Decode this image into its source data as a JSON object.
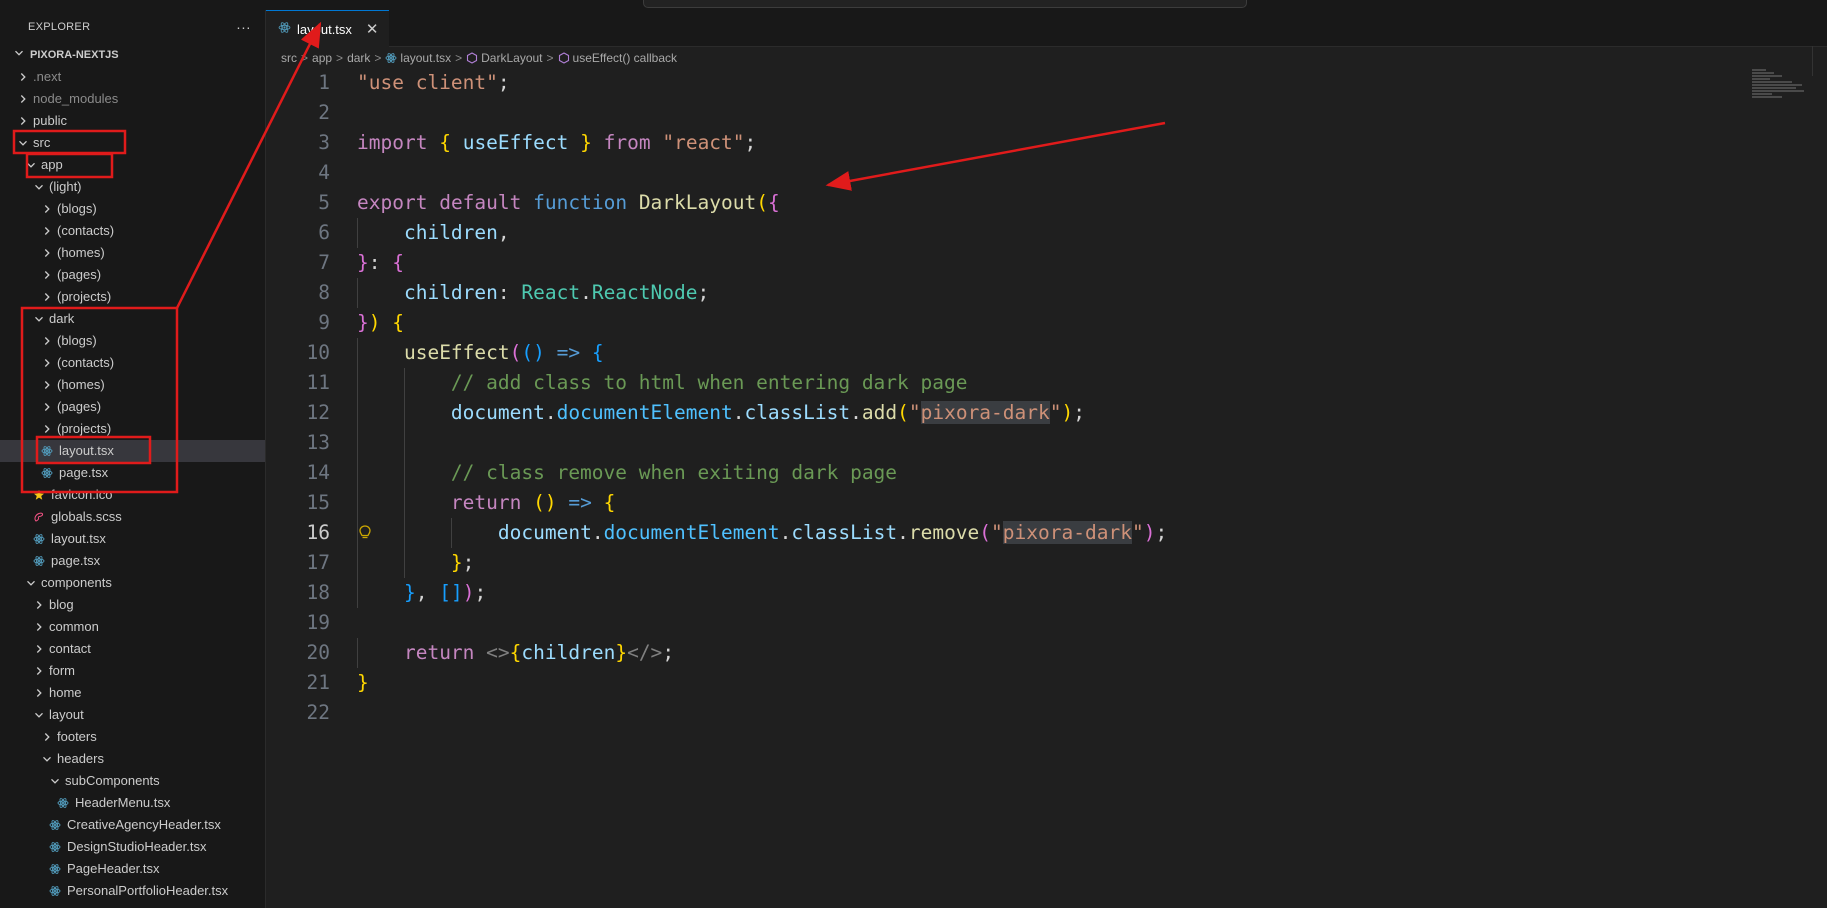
{
  "explorer": {
    "title": "EXPLORER",
    "more_label": "···",
    "project": "PIXORA-NEXTJS",
    "tree": [
      {
        "label": ".next",
        "depth": 1,
        "kind": "folder",
        "expanded": false,
        "dim": true
      },
      {
        "label": "node_modules",
        "depth": 1,
        "kind": "folder",
        "expanded": false,
        "dim": true
      },
      {
        "label": "public",
        "depth": 1,
        "kind": "folder",
        "expanded": false
      },
      {
        "label": "src",
        "depth": 1,
        "kind": "folder",
        "expanded": true
      },
      {
        "label": "app",
        "depth": 2,
        "kind": "folder",
        "expanded": true
      },
      {
        "label": "(light)",
        "depth": 3,
        "kind": "folder",
        "expanded": true
      },
      {
        "label": "(blogs)",
        "depth": 4,
        "kind": "folder",
        "expanded": false
      },
      {
        "label": "(contacts)",
        "depth": 4,
        "kind": "folder",
        "expanded": false
      },
      {
        "label": "(homes)",
        "depth": 4,
        "kind": "folder",
        "expanded": false
      },
      {
        "label": "(pages)",
        "depth": 4,
        "kind": "folder",
        "expanded": false
      },
      {
        "label": "(projects)",
        "depth": 4,
        "kind": "folder",
        "expanded": false
      },
      {
        "label": "dark",
        "depth": 3,
        "kind": "folder",
        "expanded": true
      },
      {
        "label": "(blogs)",
        "depth": 4,
        "kind": "folder",
        "expanded": false
      },
      {
        "label": "(contacts)",
        "depth": 4,
        "kind": "folder",
        "expanded": false
      },
      {
        "label": "(homes)",
        "depth": 4,
        "kind": "folder",
        "expanded": false
      },
      {
        "label": "(pages)",
        "depth": 4,
        "kind": "folder",
        "expanded": false
      },
      {
        "label": "(projects)",
        "depth": 4,
        "kind": "folder",
        "expanded": false
      },
      {
        "label": "layout.tsx",
        "depth": 4,
        "kind": "react",
        "selected": true
      },
      {
        "label": "page.tsx",
        "depth": 4,
        "kind": "react"
      },
      {
        "label": "favicon.ico",
        "depth": 3,
        "kind": "star"
      },
      {
        "label": "globals.scss",
        "depth": 3,
        "kind": "sass"
      },
      {
        "label": "layout.tsx",
        "depth": 3,
        "kind": "react"
      },
      {
        "label": "page.tsx",
        "depth": 3,
        "kind": "react"
      },
      {
        "label": "components",
        "depth": 2,
        "kind": "folder",
        "expanded": true
      },
      {
        "label": "blog",
        "depth": 3,
        "kind": "folder",
        "expanded": false
      },
      {
        "label": "common",
        "depth": 3,
        "kind": "folder",
        "expanded": false
      },
      {
        "label": "contact",
        "depth": 3,
        "kind": "folder",
        "expanded": false
      },
      {
        "label": "form",
        "depth": 3,
        "kind": "folder",
        "expanded": false
      },
      {
        "label": "home",
        "depth": 3,
        "kind": "folder",
        "expanded": false
      },
      {
        "label": "layout",
        "depth": 3,
        "kind": "folder",
        "expanded": true
      },
      {
        "label": "footers",
        "depth": 4,
        "kind": "folder",
        "expanded": false
      },
      {
        "label": "headers",
        "depth": 4,
        "kind": "folder",
        "expanded": true
      },
      {
        "label": "subComponents",
        "depth": 5,
        "kind": "folder",
        "expanded": true
      },
      {
        "label": "HeaderMenu.tsx",
        "depth": 6,
        "kind": "react"
      },
      {
        "label": "CreativeAgencyHeader.tsx",
        "depth": 5,
        "kind": "react"
      },
      {
        "label": "DesignStudioHeader.tsx",
        "depth": 5,
        "kind": "react"
      },
      {
        "label": "PageHeader.tsx",
        "depth": 5,
        "kind": "react"
      },
      {
        "label": "PersonalPortfolioHeader.tsx",
        "depth": 5,
        "kind": "react"
      }
    ]
  },
  "tab": {
    "label": "layout.tsx",
    "close": "✕"
  },
  "breadcrumb": {
    "items": [
      "src",
      "app",
      "dark",
      "layout.tsx",
      "DarkLayout",
      "useEffect() callback"
    ],
    "separator": ">"
  },
  "editor": {
    "active_line": 16,
    "lines": [
      {
        "n": "1",
        "tokens": [
          [
            "str",
            "\"use client\""
          ],
          [
            "p",
            ";"
          ]
        ]
      },
      {
        "n": "2",
        "tokens": []
      },
      {
        "n": "3",
        "tokens": [
          [
            "kw",
            "import"
          ],
          [
            "p",
            " "
          ],
          [
            "br1",
            "{"
          ],
          [
            "p",
            " "
          ],
          [
            "var",
            "useEffect"
          ],
          [
            "p",
            " "
          ],
          [
            "br1",
            "}"
          ],
          [
            "p",
            " "
          ],
          [
            "kw",
            "from"
          ],
          [
            "p",
            " "
          ],
          [
            "str",
            "\"react\""
          ],
          [
            "p",
            ";"
          ]
        ]
      },
      {
        "n": "4",
        "tokens": []
      },
      {
        "n": "5",
        "tokens": [
          [
            "kw",
            "export"
          ],
          [
            "p",
            " "
          ],
          [
            "kw",
            "default"
          ],
          [
            "p",
            " "
          ],
          [
            "kw2",
            "function"
          ],
          [
            "p",
            " "
          ],
          [
            "fn",
            "DarkLayout"
          ],
          [
            "br1",
            "("
          ],
          [
            "br2",
            "{"
          ]
        ]
      },
      {
        "n": "6",
        "tokens": [
          [
            "p",
            "    "
          ],
          [
            "var",
            "children"
          ],
          [
            "p",
            ","
          ]
        ]
      },
      {
        "n": "7",
        "tokens": [
          [
            "br2",
            "}"
          ],
          [
            "p",
            ": "
          ],
          [
            "br2",
            "{"
          ]
        ]
      },
      {
        "n": "8",
        "tokens": [
          [
            "p",
            "    "
          ],
          [
            "var",
            "children"
          ],
          [
            "p",
            ": "
          ],
          [
            "ty",
            "React"
          ],
          [
            "p",
            "."
          ],
          [
            "ty",
            "ReactNode"
          ],
          [
            "p",
            ";"
          ]
        ]
      },
      {
        "n": "9",
        "tokens": [
          [
            "br2",
            "}"
          ],
          [
            "br1",
            ")"
          ],
          [
            "p",
            " "
          ],
          [
            "br1",
            "{"
          ]
        ]
      },
      {
        "n": "10",
        "tokens": [
          [
            "p",
            "    "
          ],
          [
            "fn",
            "useEffect"
          ],
          [
            "br2",
            "("
          ],
          [
            "br3",
            "()"
          ],
          [
            "p",
            " "
          ],
          [
            "kw2",
            "=>"
          ],
          [
            "p",
            " "
          ],
          [
            "br3",
            "{"
          ]
        ]
      },
      {
        "n": "11",
        "tokens": [
          [
            "p",
            "        "
          ],
          [
            "cm",
            "// add class to html when entering dark page"
          ]
        ]
      },
      {
        "n": "12",
        "tokens": [
          [
            "p",
            "        "
          ],
          [
            "var",
            "document"
          ],
          [
            "p",
            "."
          ],
          [
            "prop",
            "documentElement"
          ],
          [
            "p",
            "."
          ],
          [
            "var",
            "classList"
          ],
          [
            "p",
            "."
          ],
          [
            "fn",
            "add"
          ],
          [
            "br1",
            "("
          ],
          [
            "str",
            "\""
          ],
          [
            "strhl",
            "pixora-dark"
          ],
          [
            "str",
            "\""
          ],
          [
            "br1",
            ")"
          ],
          [
            "p",
            ";"
          ]
        ]
      },
      {
        "n": "13",
        "tokens": []
      },
      {
        "n": "14",
        "tokens": [
          [
            "p",
            "        "
          ],
          [
            "cm",
            "// class remove when exiting dark page"
          ]
        ]
      },
      {
        "n": "15",
        "tokens": [
          [
            "p",
            "        "
          ],
          [
            "kw",
            "return"
          ],
          [
            "p",
            " "
          ],
          [
            "br1",
            "()"
          ],
          [
            "p",
            " "
          ],
          [
            "kw2",
            "=>"
          ],
          [
            "p",
            " "
          ],
          [
            "br1",
            "{"
          ]
        ]
      },
      {
        "n": "16",
        "tokens": [
          [
            "p",
            "            "
          ],
          [
            "var",
            "document"
          ],
          [
            "p",
            "."
          ],
          [
            "prop",
            "documentElement"
          ],
          [
            "p",
            "."
          ],
          [
            "var",
            "classList"
          ],
          [
            "p",
            "."
          ],
          [
            "fn",
            "remove"
          ],
          [
            "br2",
            "("
          ],
          [
            "str",
            "\""
          ],
          [
            "strhl",
            "pixora-dark"
          ],
          [
            "str",
            "\""
          ],
          [
            "br2",
            ")"
          ],
          [
            "p",
            ";"
          ]
        ]
      },
      {
        "n": "17",
        "tokens": [
          [
            "p",
            "        "
          ],
          [
            "br1",
            "}"
          ],
          [
            "p",
            ";"
          ]
        ]
      },
      {
        "n": "18",
        "tokens": [
          [
            "p",
            "    "
          ],
          [
            "br3",
            "}"
          ],
          [
            "p",
            ", "
          ],
          [
            "br3",
            "[]"
          ],
          [
            "br2",
            ")"
          ],
          [
            "p",
            ";"
          ]
        ]
      },
      {
        "n": "19",
        "tokens": []
      },
      {
        "n": "20",
        "tokens": [
          [
            "p",
            "    "
          ],
          [
            "kw",
            "return"
          ],
          [
            "p",
            " "
          ],
          [
            "tagc",
            "<>"
          ],
          [
            "br1",
            "{"
          ],
          [
            "var",
            "children"
          ],
          [
            "br1",
            "}"
          ],
          [
            "tagc",
            "</>"
          ],
          [
            "p",
            ";"
          ]
        ]
      },
      {
        "n": "21",
        "tokens": [
          [
            "br1",
            "}"
          ]
        ]
      },
      {
        "n": "22",
        "tokens": []
      }
    ]
  },
  "colors": {
    "annotation": "#e01b1b",
    "react_icon": "#519aba",
    "folder_chevron": "#cccccc"
  }
}
